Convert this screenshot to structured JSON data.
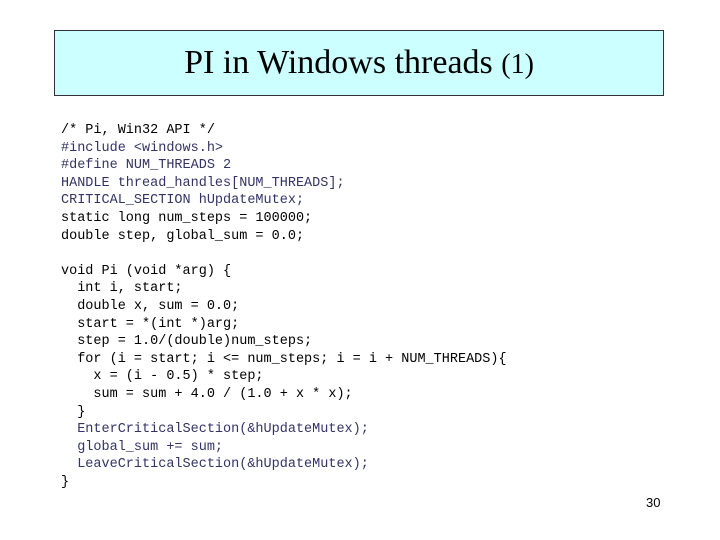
{
  "slide": {
    "title": "PI in Windows threads",
    "title_suffix": "(1)",
    "page_number": "30",
    "colors": {
      "title_background": "#ccffff",
      "code_text": "#000000",
      "code_dim_text": "#333366"
    }
  },
  "code": {
    "lines": [
      {
        "text": "/* Pi, Win32 API */",
        "dim": false
      },
      {
        "text": "#include <windows.h>",
        "dim": true
      },
      {
        "text": "#define NUM_THREADS 2",
        "dim": true
      },
      {
        "text": "HANDLE thread_handles[NUM_THREADS];",
        "dim": true
      },
      {
        "text": "CRITICAL_SECTION hUpdateMutex;",
        "dim": true
      },
      {
        "text": "static long num_steps = 100000;",
        "dim": false
      },
      {
        "text": "double step, global_sum = 0.0;",
        "dim": false
      },
      {
        "text": "",
        "dim": false
      },
      {
        "text": "void Pi (void *arg) {",
        "dim": false
      },
      {
        "text": "  int i, start;",
        "dim": false
      },
      {
        "text": "  double x, sum = 0.0;",
        "dim": false
      },
      {
        "text": "  start = *(int *)arg;",
        "dim": false
      },
      {
        "text": "  step = 1.0/(double)num_steps;",
        "dim": false
      },
      {
        "text": "  for (i = start; i <= num_steps; i = i + NUM_THREADS){",
        "dim": false
      },
      {
        "text": "    x = (i - 0.5) * step;",
        "dim": false
      },
      {
        "text": "    sum = sum + 4.0 / (1.0 + x * x);",
        "dim": false
      },
      {
        "text": "  }",
        "dim": false
      },
      {
        "text": "  EnterCriticalSection(&hUpdateMutex);",
        "dim": true
      },
      {
        "text": "  global_sum += sum;",
        "dim": true
      },
      {
        "text": "  LeaveCriticalSection(&hUpdateMutex);",
        "dim": true
      },
      {
        "text": "}",
        "dim": false
      }
    ]
  }
}
